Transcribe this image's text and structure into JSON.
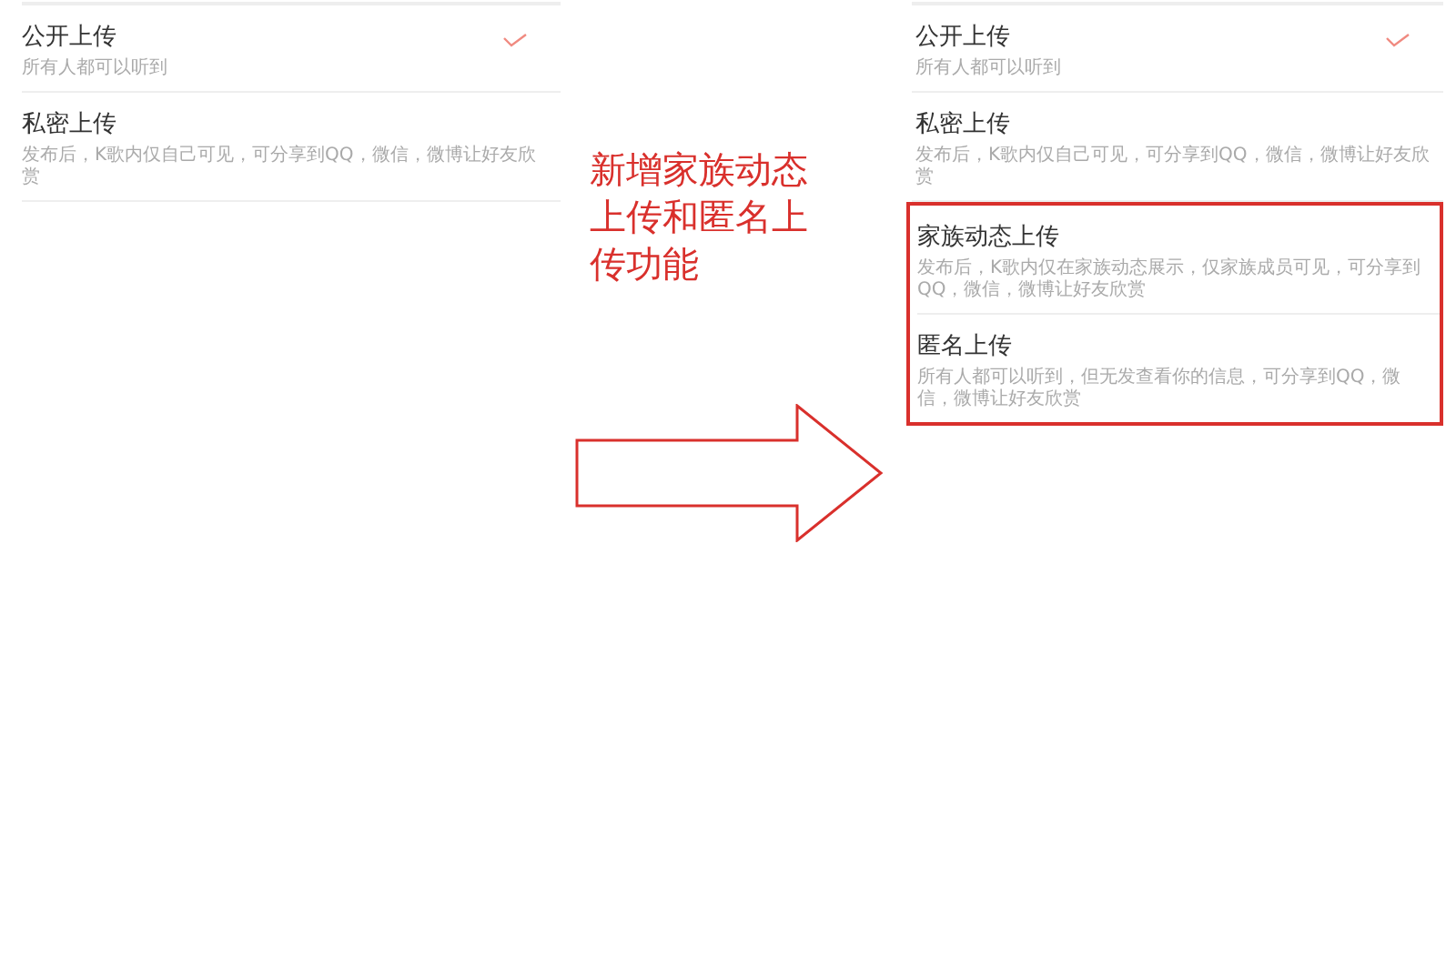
{
  "panels": [
    {
      "options": [
        {
          "title": "公开上传",
          "subtitle": "所有人都可以听到",
          "selected": true
        },
        {
          "title": "私密上传",
          "subtitle": "发布后，K歌内仅自己可见，可分享到QQ，微信，微博让好友欣赏",
          "selected": false
        }
      ]
    },
    {
      "options": [
        {
          "title": "公开上传",
          "subtitle": "所有人都可以听到",
          "selected": true
        },
        {
          "title": "私密上传",
          "subtitle": "发布后，K歌内仅自己可见，可分享到QQ，微信，微博让好友欣赏",
          "selected": false
        }
      ],
      "new_options": [
        {
          "title": "家族动态上传",
          "subtitle": "发布后，K歌内仅在家族动态展示，仅家族成员可见，可分享到QQ，微信，微博让好友欣赏",
          "selected": false
        },
        {
          "title": "匿名上传",
          "subtitle": "所有人都可以听到，但无发查看你的信息，可分享到QQ，微信，微博让好友欣赏",
          "selected": false
        }
      ]
    }
  ],
  "annotation": "新增家族动态上传和匿名上传功能"
}
